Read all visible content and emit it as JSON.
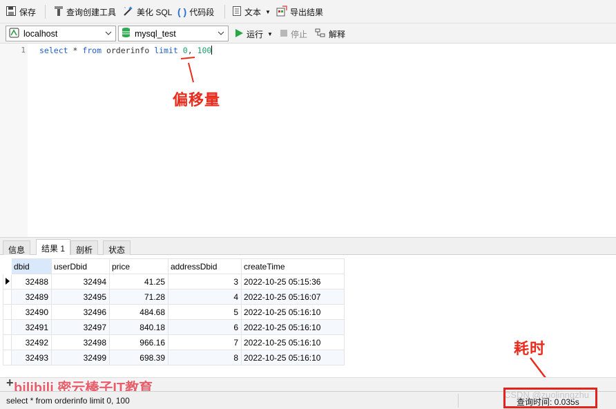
{
  "toolbar": {
    "save": "保存",
    "query_builder": "查询创建工具",
    "beautify": "美化 SQL",
    "snippet": "代码段",
    "text": "文本",
    "export": "导出结果"
  },
  "connection": {
    "host": "localhost",
    "database": "mysql_test"
  },
  "actions": {
    "run": "运行",
    "stop": "停止",
    "explain": "解释"
  },
  "editor": {
    "line_number": "1",
    "tokens": {
      "select": "select",
      "star": " * ",
      "from": "from",
      "table": " orderinfo ",
      "limit": "limit",
      "offset": "0",
      "comma": ", ",
      "count": "100"
    }
  },
  "annotations": {
    "offset_label": "偏移量",
    "time_label": "耗时"
  },
  "tabs": [
    "信息",
    "结果 1",
    "剖析",
    "状态"
  ],
  "active_tab": "结果 1",
  "table": {
    "columns": [
      "dbid",
      "userDbid",
      "price",
      "addressDbid",
      "createTime"
    ],
    "rows": [
      [
        "32488",
        "32494",
        "41.25",
        "3",
        "2022-10-25 05:15:36"
      ],
      [
        "32489",
        "32495",
        "71.28",
        "4",
        "2022-10-25 05:16:07"
      ],
      [
        "32490",
        "32496",
        "484.68",
        "5",
        "2022-10-25 05:16:10"
      ],
      [
        "32491",
        "32497",
        "840.18",
        "6",
        "2022-10-25 05:16:10"
      ],
      [
        "32492",
        "32498",
        "966.16",
        "7",
        "2022-10-25 05:16:10"
      ],
      [
        "32493",
        "32499",
        "698.39",
        "8",
        "2022-10-25 05:16:10"
      ]
    ]
  },
  "status": {
    "sql": "select * from orderinfo limit 0, 100",
    "time": "查询时间: 0.035s"
  },
  "watermarks": {
    "bilibili": "bilibili 密云榛子IT教育",
    "csdn": "CSDN @zuolinngzhu"
  },
  "colors": {
    "annotation_red": "#ea2a1a",
    "keyword_blue": "#1f5ec8",
    "number_green": "#1aa06a"
  },
  "icons": [
    "save-icon",
    "query-builder-icon",
    "beautify-icon",
    "snippet-icon",
    "text-icon",
    "export-icon",
    "connection-icon",
    "database-icon",
    "run-icon",
    "stop-icon",
    "explain-icon",
    "add-icon",
    "row-pointer-icon"
  ]
}
